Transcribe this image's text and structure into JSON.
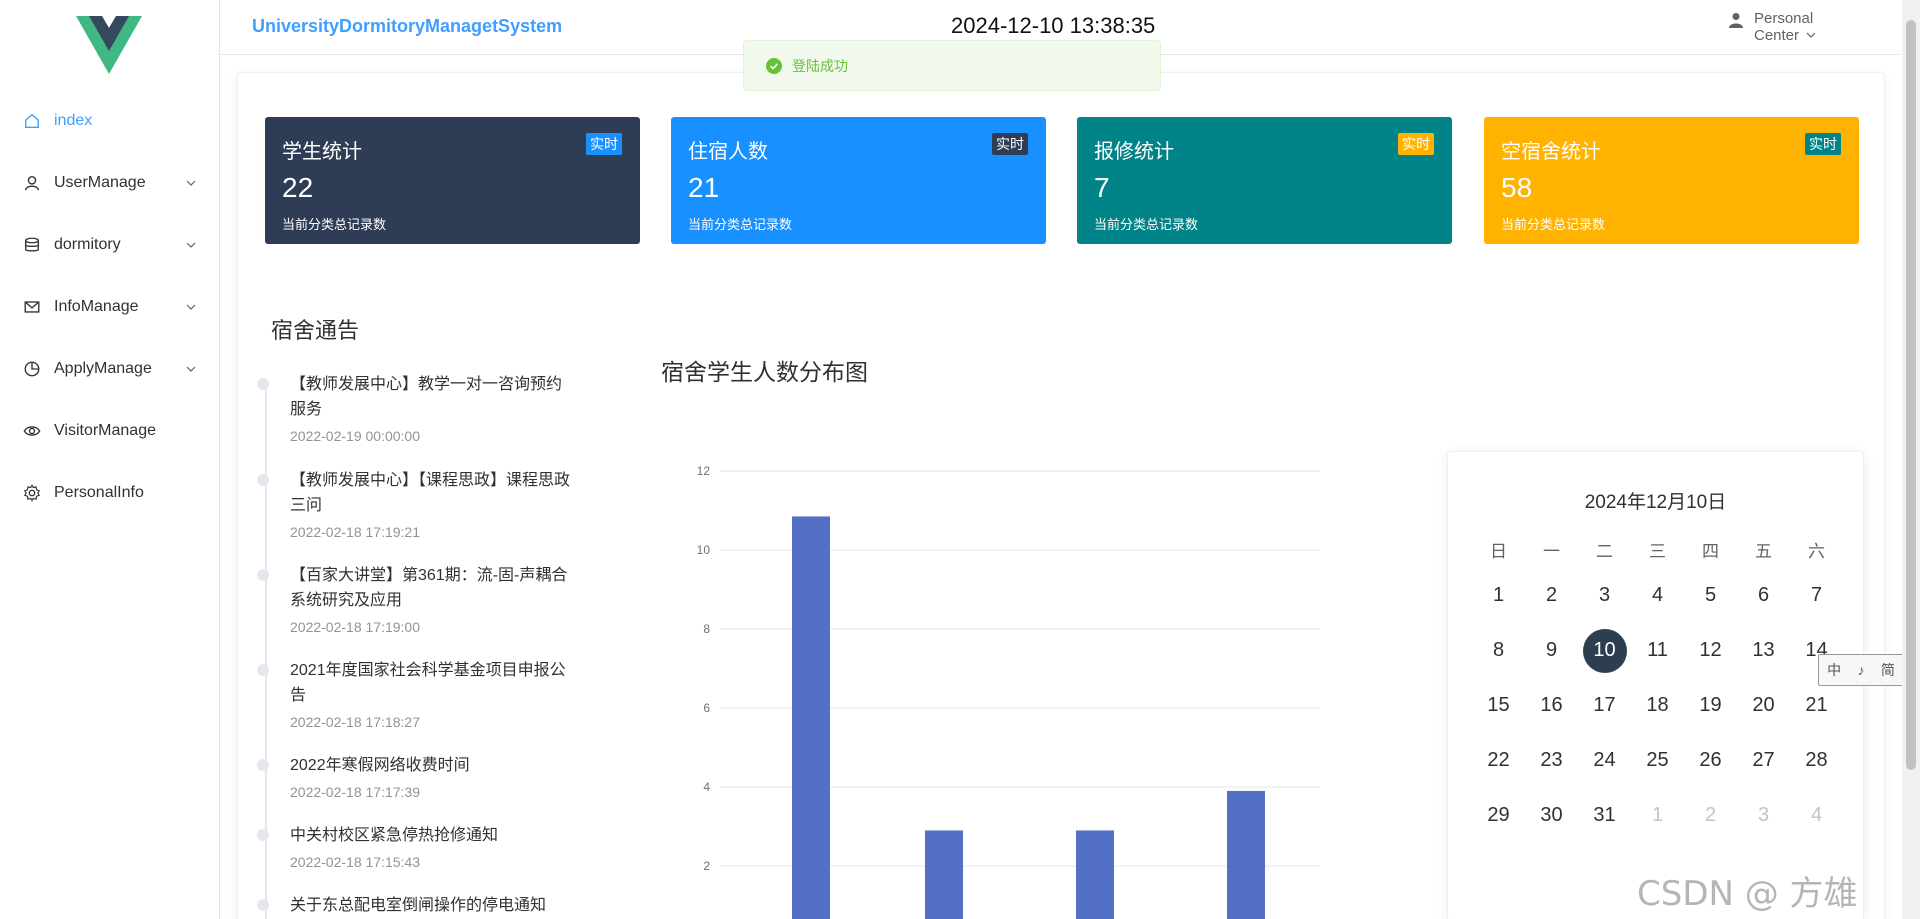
{
  "header": {
    "system_title": "UniversityDormitoryManagetSystem",
    "datetime": "2024-12-10 13:38:35",
    "personal_center": "Personal Center"
  },
  "toast": {
    "message": "登陆成功",
    "icon": "check-circle-icon",
    "color": "#67c23a"
  },
  "sidebar": {
    "items": [
      {
        "label": "index",
        "icon": "home-icon",
        "active": true,
        "submenu": false
      },
      {
        "label": "UserManage",
        "icon": "user-icon",
        "submenu": true
      },
      {
        "label": "dormitory",
        "icon": "database-icon",
        "submenu": true
      },
      {
        "label": "InfoManage",
        "icon": "mail-icon",
        "submenu": true
      },
      {
        "label": "ApplyManage",
        "icon": "pie-chart-icon",
        "submenu": true
      },
      {
        "label": "VisitorManage",
        "icon": "eye-icon",
        "submenu": false
      },
      {
        "label": "PersonalInfo",
        "icon": "gear-icon",
        "submenu": false
      }
    ]
  },
  "stats": [
    {
      "title": "学生统计",
      "value": "22",
      "desc": "当前分类总记录数",
      "badge": "实时",
      "bg": "#2e3d55",
      "badge_bg": "#1890ff"
    },
    {
      "title": "住宿人数",
      "value": "21",
      "desc": "当前分类总记录数",
      "badge": "实时",
      "bg": "#1890ff",
      "badge_bg": "#2e3d55"
    },
    {
      "title": "报修统计",
      "value": "7",
      "desc": "当前分类总记录数",
      "badge": "实时",
      "bg": "#008487",
      "badge_bg": "#ffb300"
    },
    {
      "title": "空宿舍统计",
      "value": "58",
      "desc": "当前分类总记录数",
      "badge": "实时",
      "bg": "#ffb300",
      "badge_bg": "#008487"
    }
  ],
  "notices": {
    "title": "宿舍通告",
    "items": [
      {
        "text": "【教师发展中心】教学一对一咨询预约服务",
        "time": "2022-02-19 00:00:00"
      },
      {
        "text": "【教师发展中心】【课程思政】课程思政三问",
        "time": "2022-02-18 17:19:21"
      },
      {
        "text": "【百家大讲堂】第361期：流-固-声耦合系统研究及应用",
        "time": "2022-02-18 17:19:00"
      },
      {
        "text": "2021年度国家社会科学基金项目申报公告",
        "time": "2022-02-18 17:18:27"
      },
      {
        "text": "2022年寒假网络收费时间",
        "time": "2022-02-18 17:17:39"
      },
      {
        "text": "中关村校区紧急停热抢修通知",
        "time": "2022-02-18 17:15:43"
      },
      {
        "text": "关于东总配电室倒闸操作的停电通知",
        "time": ""
      }
    ]
  },
  "chart_title": "宿舍学生人数分布图",
  "chart_data": {
    "type": "bar",
    "title": "宿舍学生人数分布图",
    "categories": [
      "",
      "",
      "",
      ""
    ],
    "values": [
      10.85,
      2.9,
      2.9,
      3.9
    ],
    "ylim": [
      0,
      12
    ],
    "yticks": [
      2,
      4,
      6,
      8,
      10,
      12
    ],
    "grid": true,
    "bar_color": "#5470c6"
  },
  "calendar": {
    "header": "2024年12月10日",
    "weekdays": [
      "日",
      "一",
      "二",
      "三",
      "四",
      "五",
      "六"
    ],
    "today": 10,
    "days": [
      {
        "d": "1",
        "cur": true
      },
      {
        "d": "2",
        "cur": true
      },
      {
        "d": "3",
        "cur": true
      },
      {
        "d": "4",
        "cur": true
      },
      {
        "d": "5",
        "cur": true
      },
      {
        "d": "6",
        "cur": true
      },
      {
        "d": "7",
        "cur": true
      },
      {
        "d": "8",
        "cur": true
      },
      {
        "d": "9",
        "cur": true
      },
      {
        "d": "10",
        "cur": true
      },
      {
        "d": "11",
        "cur": true
      },
      {
        "d": "12",
        "cur": true
      },
      {
        "d": "13",
        "cur": true
      },
      {
        "d": "14",
        "cur": true
      },
      {
        "d": "15",
        "cur": true
      },
      {
        "d": "16",
        "cur": true
      },
      {
        "d": "17",
        "cur": true
      },
      {
        "d": "18",
        "cur": true
      },
      {
        "d": "19",
        "cur": true
      },
      {
        "d": "20",
        "cur": true
      },
      {
        "d": "21",
        "cur": true
      },
      {
        "d": "22",
        "cur": true
      },
      {
        "d": "23",
        "cur": true
      },
      {
        "d": "24",
        "cur": true
      },
      {
        "d": "25",
        "cur": true
      },
      {
        "d": "26",
        "cur": true
      },
      {
        "d": "27",
        "cur": true
      },
      {
        "d": "28",
        "cur": true
      },
      {
        "d": "29",
        "cur": true
      },
      {
        "d": "30",
        "cur": true
      },
      {
        "d": "31",
        "cur": true
      },
      {
        "d": "1",
        "cur": false
      },
      {
        "d": "2",
        "cur": false
      },
      {
        "d": "3",
        "cur": false
      },
      {
        "d": "4",
        "cur": false
      }
    ]
  },
  "ime": {
    "chars": [
      "中",
      "♪",
      "简"
    ]
  },
  "watermark": "CSDN @ 方雄"
}
